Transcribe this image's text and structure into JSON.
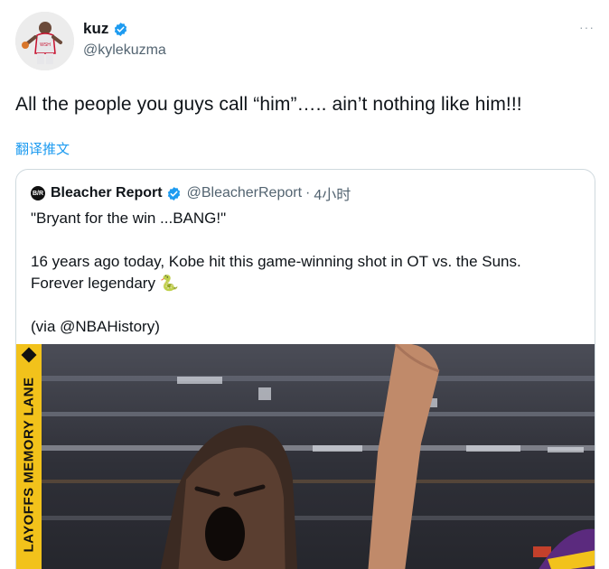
{
  "author": {
    "display_name": "kuz",
    "handle": "@kylekuzma"
  },
  "tweet": {
    "text": "All the people you guys call “him”….. ain’t nothing like him!!!",
    "translate_label": "翻译推文",
    "more_label": "···"
  },
  "quote": {
    "logo_text": "B/R",
    "display_name": "Bleacher Report",
    "handle": "@BleacherReport",
    "separator": "·",
    "time": "4小时",
    "lines": [
      "\"Bryant for the win ...BANG!\"",
      "",
      "16 years ago today, Kobe hit this game-winning shot in OT vs. the Suns.",
      "Forever legendary 🐍",
      "",
      "(via @NBAHistory)"
    ],
    "media": {
      "banner_text": "LAYOFFS MEMORY LANE"
    }
  },
  "colors": {
    "link": "#1d9bf0",
    "verified": "#1d9bf0",
    "banner": "#f2c21b"
  }
}
